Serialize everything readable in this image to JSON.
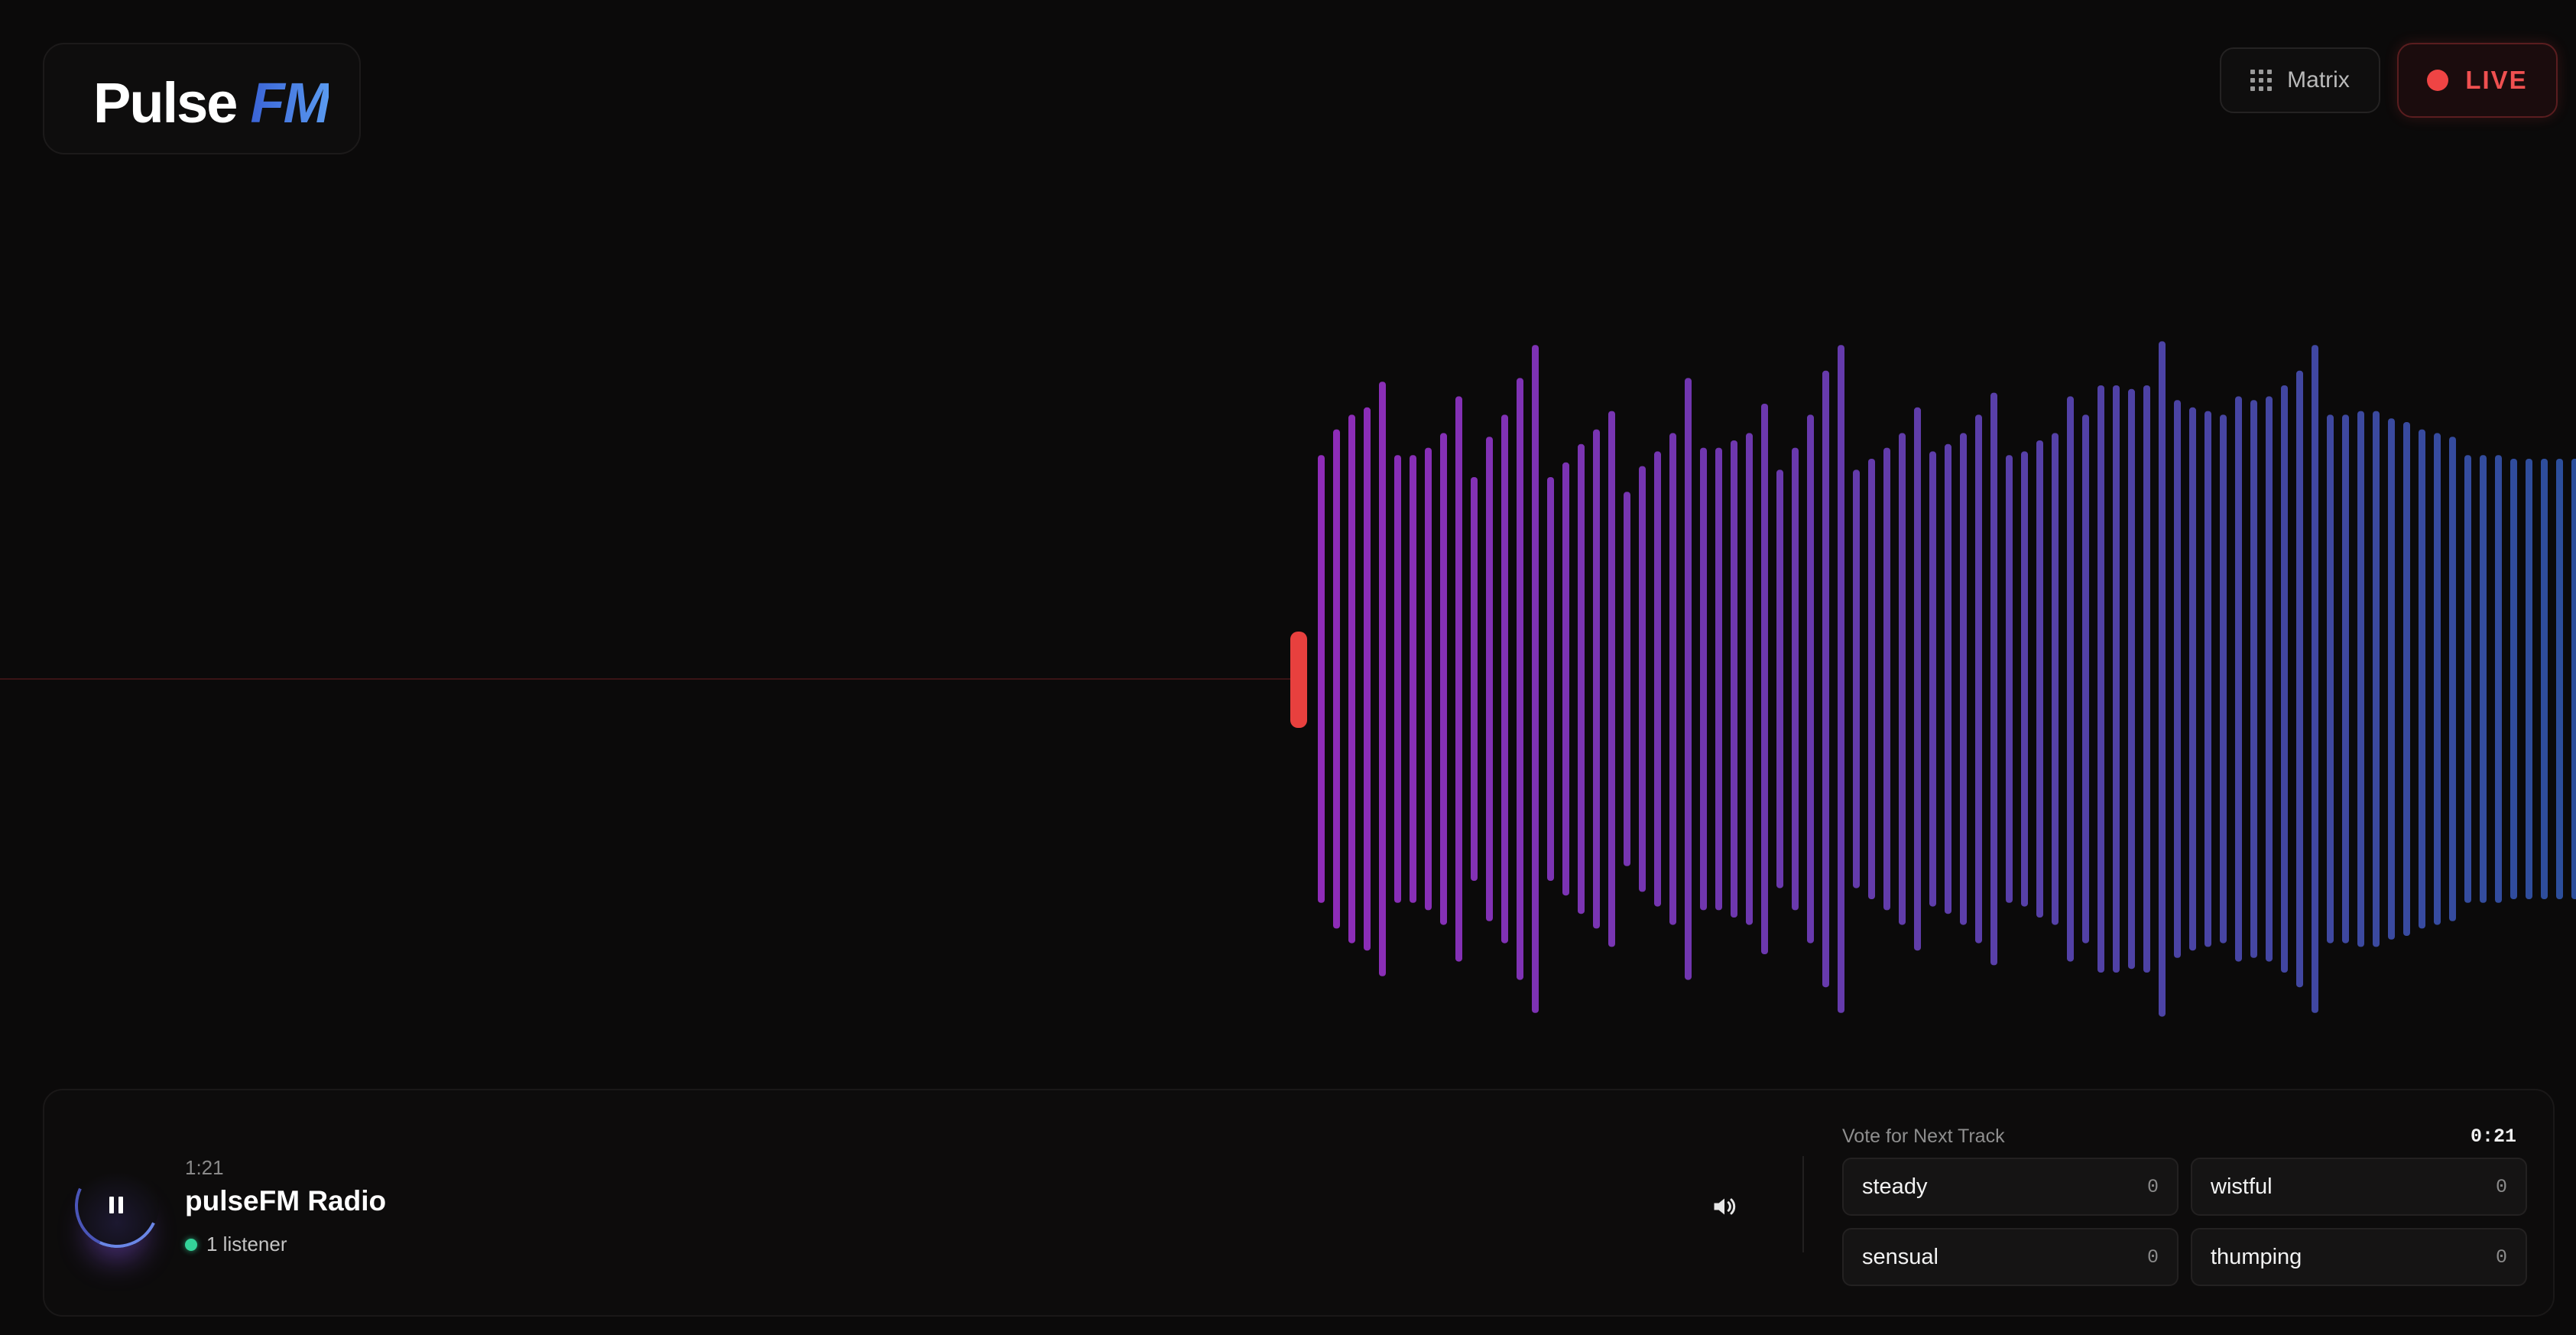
{
  "header": {
    "logo_main": "Pulse",
    "logo_accent": "FM",
    "matrix_label": "Matrix",
    "live_label": "LIVE"
  },
  "player": {
    "elapsed": "1:21",
    "station_name": "pulseFM Radio",
    "listeners": "1 listener",
    "state": "playing"
  },
  "vote": {
    "title": "Vote for Next Track",
    "timer": "0:21",
    "options": [
      {
        "label": "steady",
        "count": "0"
      },
      {
        "label": "wistful",
        "count": "0"
      },
      {
        "label": "sensual",
        "count": "0"
      },
      {
        "label": "thumping",
        "count": "0"
      }
    ]
  },
  "colors": {
    "background": "#0b0a0a",
    "live_red": "#ef4444",
    "wave_start": "#9b30c8",
    "wave_end": "#2f55a8",
    "listener_green": "#34d399"
  },
  "waveform": {
    "amplitudes": [
      0.61,
      0.68,
      0.72,
      0.74,
      0.81,
      0.61,
      0.61,
      0.63,
      0.67,
      0.77,
      0.55,
      0.66,
      0.72,
      0.82,
      0.91,
      0.55,
      0.59,
      0.64,
      0.68,
      0.73,
      0.51,
      0.58,
      0.62,
      0.67,
      0.82,
      0.63,
      0.63,
      0.65,
      0.67,
      0.75,
      0.57,
      0.63,
      0.72,
      0.84,
      0.91,
      0.57,
      0.6,
      0.63,
      0.67,
      0.74,
      0.62,
      0.64,
      0.67,
      0.72,
      0.78,
      0.61,
      0.62,
      0.65,
      0.67,
      0.77,
      0.72,
      0.8,
      0.8,
      0.79,
      0.8,
      0.92,
      0.76,
      0.74,
      0.73,
      0.72,
      0.77,
      0.76,
      0.77,
      0.8,
      0.84,
      0.91,
      0.72,
      0.72,
      0.73,
      0.73,
      0.71,
      0.7,
      0.68,
      0.67,
      0.66,
      0.61,
      0.61,
      0.61,
      0.6,
      0.6,
      0.6,
      0.6,
      0.6
    ]
  }
}
